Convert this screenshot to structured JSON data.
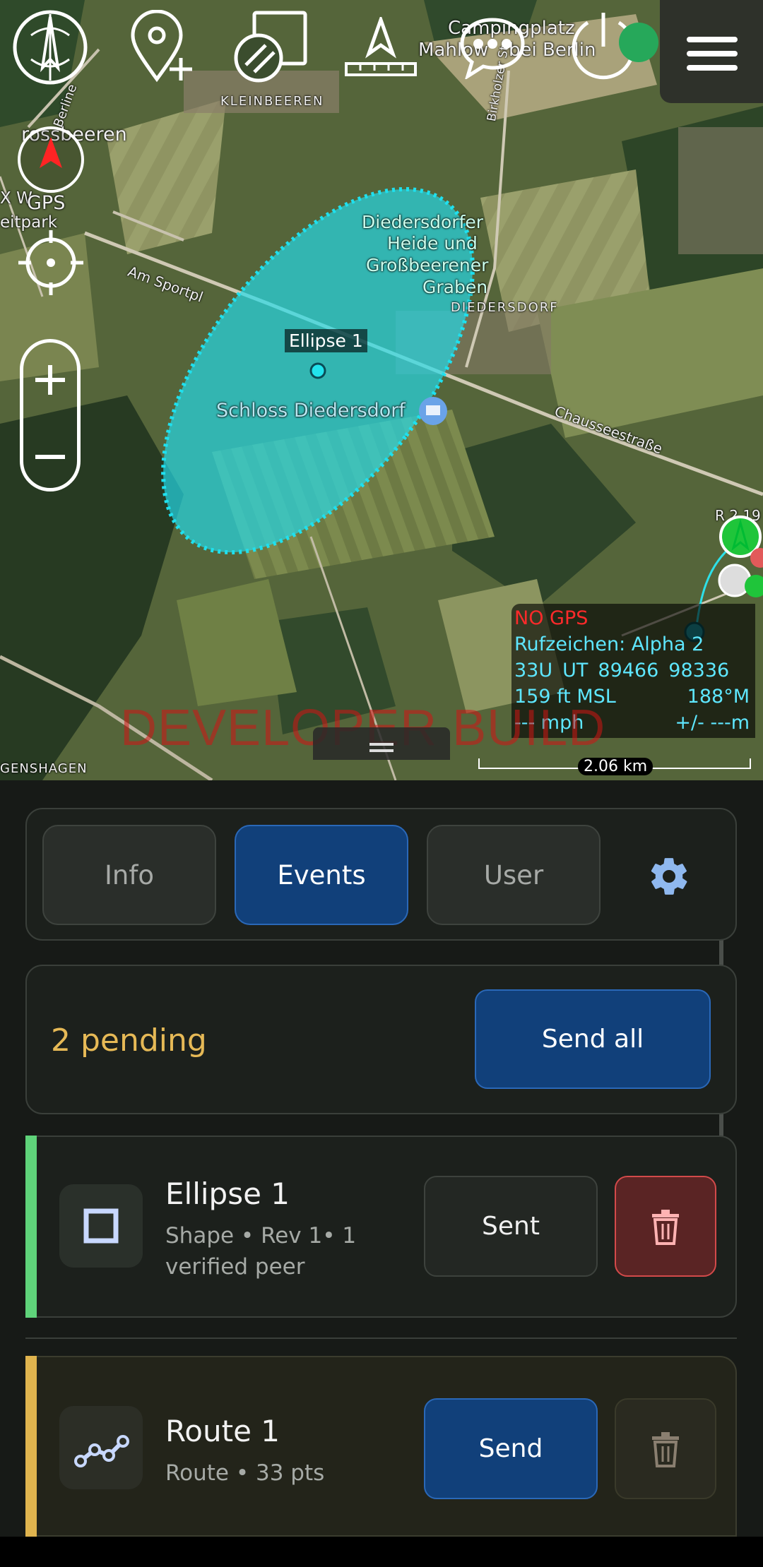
{
  "map": {
    "place_labels": [
      {
        "id": "kleinbeeren",
        "text": "KLEINBEEREN"
      },
      {
        "id": "grossbeeren",
        "text": "rossbeeren"
      },
      {
        "id": "xw",
        "text": "X W"
      },
      {
        "id": "eitpark",
        "text": "eitpark"
      },
      {
        "id": "campingplatz",
        "text": "Campingplatz"
      },
      {
        "id": "mahlow",
        "text": "Mahlow"
      },
      {
        "id": "beiberlin",
        "text": "bei Berlin"
      },
      {
        "id": "amsportpl",
        "text": "Am Sportpl"
      },
      {
        "id": "berliner",
        "text": "Berline"
      },
      {
        "id": "heide1",
        "text": "Diedersdorfer"
      },
      {
        "id": "heide2",
        "text": "Heide und"
      },
      {
        "id": "heide3",
        "text": "Großbeerener"
      },
      {
        "id": "heide4",
        "text": "Graben"
      },
      {
        "id": "diedersdorf",
        "text": "DIEDERSDORF"
      },
      {
        "id": "schloss",
        "text": "Schloss Diedersdorf"
      },
      {
        "id": "chaussee",
        "text": "Chausseestraße"
      },
      {
        "id": "birkholzer",
        "text": "Birkholzer Str"
      },
      {
        "id": "genshagen",
        "text": "GENSHAGEN"
      },
      {
        "id": "rc19",
        "text": "R 2 19"
      }
    ],
    "gps_button_label": "GPS",
    "ellipse_label": "Ellipse 1",
    "watermark": "DEVELOPER BUILD",
    "scale_label": "2.06 km",
    "gps_panel": {
      "status": "NO GPS",
      "callsign": "Rufzeichen: Alpha 2",
      "mgrs_zone": "33U",
      "mgrs_square": "UT",
      "easting": "89466",
      "northing": "98336",
      "altitude": "159 ft MSL",
      "heading": "188°M",
      "speed": "--- mph",
      "accuracy": "+/- ---m"
    }
  },
  "panel": {
    "tabs": [
      {
        "label": "Info",
        "active": false
      },
      {
        "label": "Events",
        "active": true
      },
      {
        "label": "User",
        "active": false
      }
    ],
    "pending_text": "2 pending",
    "send_all_label": "Send all",
    "items": [
      {
        "title": "Ellipse 1",
        "subtitle_line1": "Shape • Rev 1• 1",
        "subtitle_line2": "verified peer",
        "action_label": "Sent",
        "stripe_color": "#5fd37a"
      },
      {
        "title": "Route 1",
        "subtitle_line1": "Route • 33 pts",
        "action_label": "Send",
        "stripe_color": "#e0b44e"
      }
    ]
  },
  "colors": {
    "accent_blue": "#11407a",
    "pending_yellow": "#e6b956",
    "danger_red": "#d34a4a",
    "cyan": "#22e3ec"
  }
}
